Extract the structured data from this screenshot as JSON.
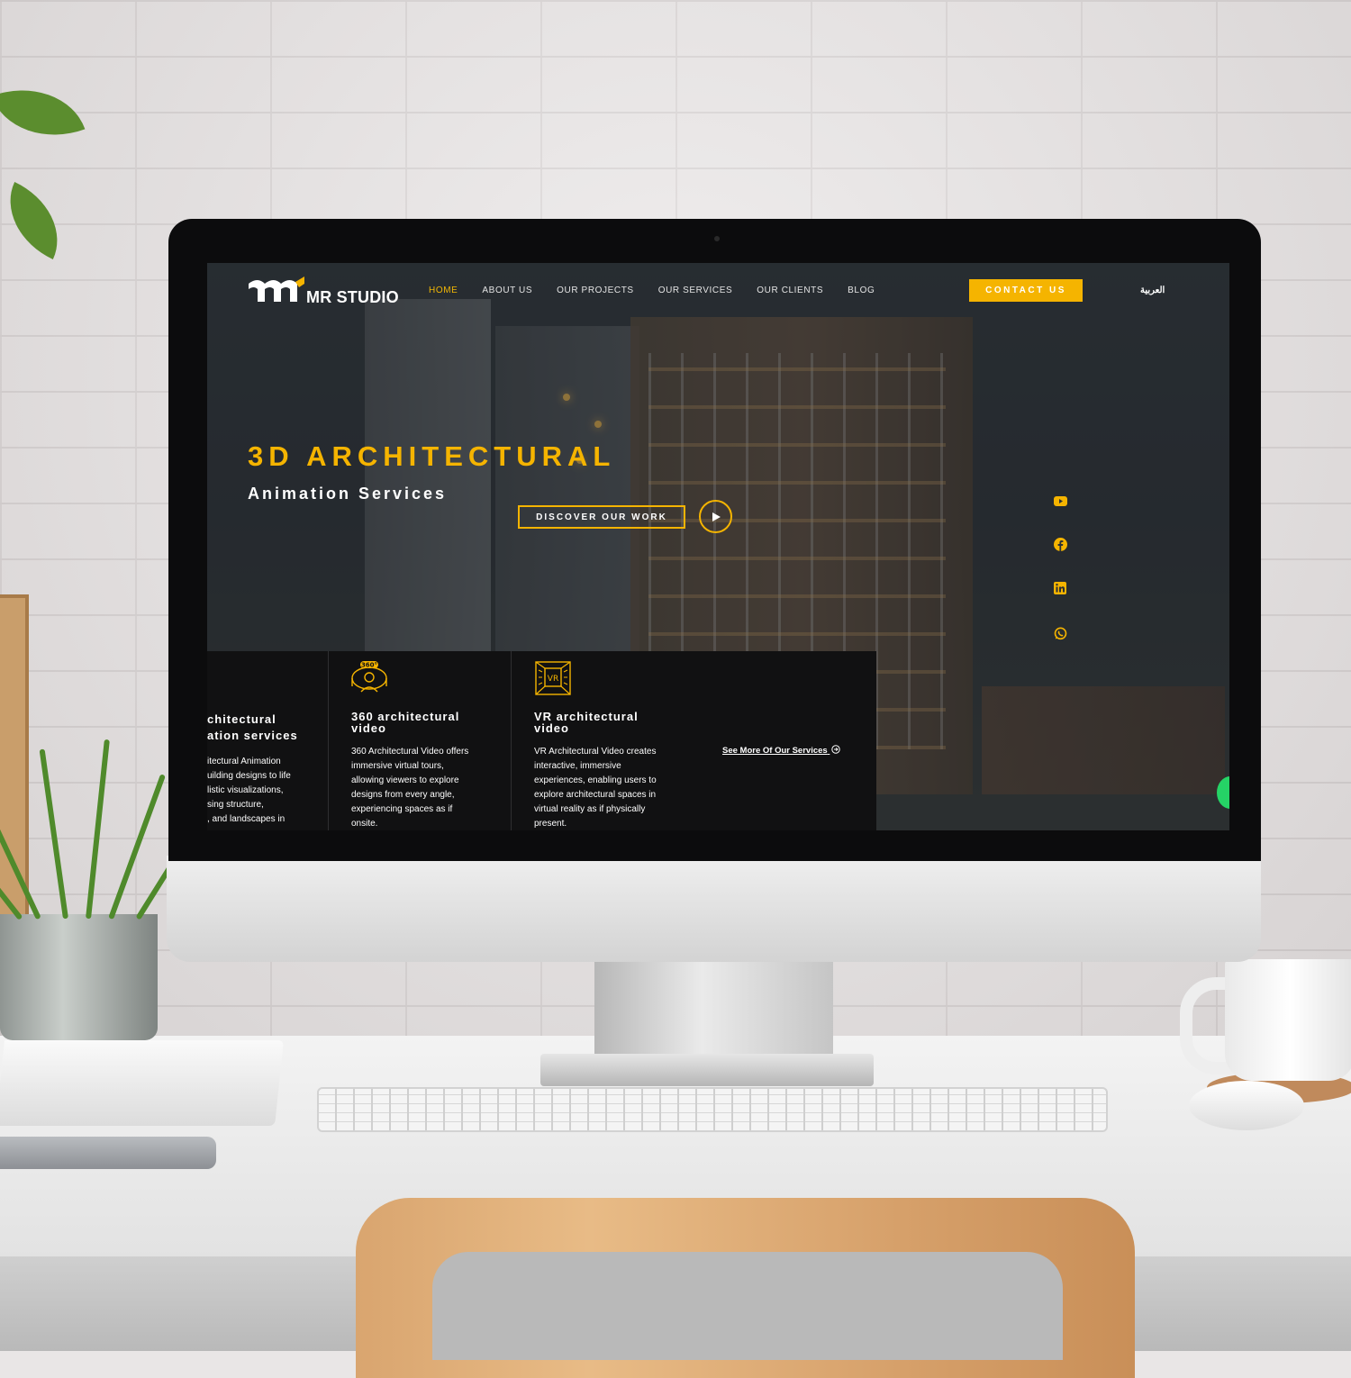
{
  "site": {
    "logo_text": "MR STUDIO",
    "nav": [
      {
        "label": "HOME",
        "active": true
      },
      {
        "label": "ABOUT US",
        "active": false
      },
      {
        "label": "OUR PROJECTS",
        "active": false
      },
      {
        "label": "OUR SERVICES",
        "active": false
      },
      {
        "label": "OUR CLIENTS",
        "active": false
      },
      {
        "label": "BLOG",
        "active": false
      }
    ],
    "contact_label": "CONTACT US",
    "language_label": "العربية"
  },
  "hero": {
    "title": "3D ARCHITECTURAL",
    "subtitle": "Animation Services",
    "discover_label": "DISCOVER OUR WORK"
  },
  "social": [
    "youtube-icon",
    "facebook-icon",
    "linkedin-icon",
    "whatsapp-icon"
  ],
  "services": {
    "items": [
      {
        "title_lines": [
          "chitectural",
          "ation services"
        ],
        "desc_lines": [
          "itectural Animation",
          "uilding designs to life",
          "listic visualizations,",
          "sing structure,",
          ", and landscapes in"
        ]
      },
      {
        "icon": "360-video-icon",
        "title_lines": [
          "360 architectural",
          "video"
        ],
        "desc_lines": [
          "360 Architectural Video offers",
          "immersive virtual tours,",
          "allowing viewers to explore",
          "designs from every angle,",
          "experiencing spaces as if",
          "onsite."
        ]
      },
      {
        "icon": "vr-icon",
        "title_lines": [
          "VR architectural",
          "video"
        ],
        "desc_lines": [
          "VR Architectural Video creates",
          "interactive, immersive",
          "experiences, enabling users to",
          "explore architectural spaces in",
          "virtual reality as if physically",
          "present."
        ]
      }
    ],
    "see_more_label": "See More Of Our Services"
  },
  "colors": {
    "accent": "#f5b400",
    "panel": "#111112",
    "nav_text": "#e4e4e4"
  }
}
